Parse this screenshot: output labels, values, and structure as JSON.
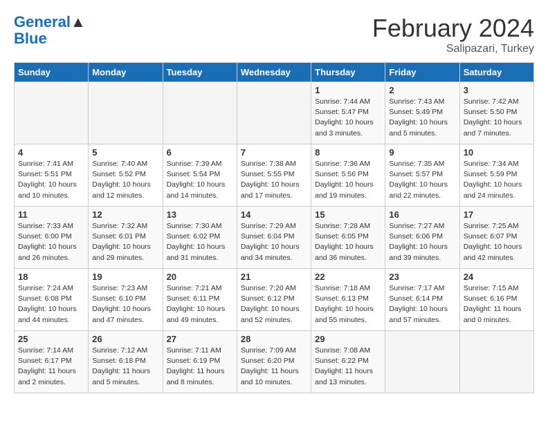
{
  "header": {
    "logo_line1": "General",
    "logo_line2": "Blue",
    "month": "February 2024",
    "location": "Salipazari, Turkey"
  },
  "weekdays": [
    "Sunday",
    "Monday",
    "Tuesday",
    "Wednesday",
    "Thursday",
    "Friday",
    "Saturday"
  ],
  "weeks": [
    [
      {
        "day": "",
        "info": ""
      },
      {
        "day": "",
        "info": ""
      },
      {
        "day": "",
        "info": ""
      },
      {
        "day": "",
        "info": ""
      },
      {
        "day": "1",
        "info": "Sunrise: 7:44 AM\nSunset: 5:47 PM\nDaylight: 10 hours\nand 3 minutes."
      },
      {
        "day": "2",
        "info": "Sunrise: 7:43 AM\nSunset: 5:49 PM\nDaylight: 10 hours\nand 5 minutes."
      },
      {
        "day": "3",
        "info": "Sunrise: 7:42 AM\nSunset: 5:50 PM\nDaylight: 10 hours\nand 7 minutes."
      }
    ],
    [
      {
        "day": "4",
        "info": "Sunrise: 7:41 AM\nSunset: 5:51 PM\nDaylight: 10 hours\nand 10 minutes."
      },
      {
        "day": "5",
        "info": "Sunrise: 7:40 AM\nSunset: 5:52 PM\nDaylight: 10 hours\nand 12 minutes."
      },
      {
        "day": "6",
        "info": "Sunrise: 7:39 AM\nSunset: 5:54 PM\nDaylight: 10 hours\nand 14 minutes."
      },
      {
        "day": "7",
        "info": "Sunrise: 7:38 AM\nSunset: 5:55 PM\nDaylight: 10 hours\nand 17 minutes."
      },
      {
        "day": "8",
        "info": "Sunrise: 7:36 AM\nSunset: 5:56 PM\nDaylight: 10 hours\nand 19 minutes."
      },
      {
        "day": "9",
        "info": "Sunrise: 7:35 AM\nSunset: 5:57 PM\nDaylight: 10 hours\nand 22 minutes."
      },
      {
        "day": "10",
        "info": "Sunrise: 7:34 AM\nSunset: 5:59 PM\nDaylight: 10 hours\nand 24 minutes."
      }
    ],
    [
      {
        "day": "11",
        "info": "Sunrise: 7:33 AM\nSunset: 6:00 PM\nDaylight: 10 hours\nand 26 minutes."
      },
      {
        "day": "12",
        "info": "Sunrise: 7:32 AM\nSunset: 6:01 PM\nDaylight: 10 hours\nand 29 minutes."
      },
      {
        "day": "13",
        "info": "Sunrise: 7:30 AM\nSunset: 6:02 PM\nDaylight: 10 hours\nand 31 minutes."
      },
      {
        "day": "14",
        "info": "Sunrise: 7:29 AM\nSunset: 6:04 PM\nDaylight: 10 hours\nand 34 minutes."
      },
      {
        "day": "15",
        "info": "Sunrise: 7:28 AM\nSunset: 6:05 PM\nDaylight: 10 hours\nand 36 minutes."
      },
      {
        "day": "16",
        "info": "Sunrise: 7:27 AM\nSunset: 6:06 PM\nDaylight: 10 hours\nand 39 minutes."
      },
      {
        "day": "17",
        "info": "Sunrise: 7:25 AM\nSunset: 6:07 PM\nDaylight: 10 hours\nand 42 minutes."
      }
    ],
    [
      {
        "day": "18",
        "info": "Sunrise: 7:24 AM\nSunset: 6:08 PM\nDaylight: 10 hours\nand 44 minutes."
      },
      {
        "day": "19",
        "info": "Sunrise: 7:23 AM\nSunset: 6:10 PM\nDaylight: 10 hours\nand 47 minutes."
      },
      {
        "day": "20",
        "info": "Sunrise: 7:21 AM\nSunset: 6:11 PM\nDaylight: 10 hours\nand 49 minutes."
      },
      {
        "day": "21",
        "info": "Sunrise: 7:20 AM\nSunset: 6:12 PM\nDaylight: 10 hours\nand 52 minutes."
      },
      {
        "day": "22",
        "info": "Sunrise: 7:18 AM\nSunset: 6:13 PM\nDaylight: 10 hours\nand 55 minutes."
      },
      {
        "day": "23",
        "info": "Sunrise: 7:17 AM\nSunset: 6:14 PM\nDaylight: 10 hours\nand 57 minutes."
      },
      {
        "day": "24",
        "info": "Sunrise: 7:15 AM\nSunset: 6:16 PM\nDaylight: 11 hours\nand 0 minutes."
      }
    ],
    [
      {
        "day": "25",
        "info": "Sunrise: 7:14 AM\nSunset: 6:17 PM\nDaylight: 11 hours\nand 2 minutes."
      },
      {
        "day": "26",
        "info": "Sunrise: 7:12 AM\nSunset: 6:18 PM\nDaylight: 11 hours\nand 5 minutes."
      },
      {
        "day": "27",
        "info": "Sunrise: 7:11 AM\nSunset: 6:19 PM\nDaylight: 11 hours\nand 8 minutes."
      },
      {
        "day": "28",
        "info": "Sunrise: 7:09 AM\nSunset: 6:20 PM\nDaylight: 11 hours\nand 10 minutes."
      },
      {
        "day": "29",
        "info": "Sunrise: 7:08 AM\nSunset: 6:22 PM\nDaylight: 11 hours\nand 13 minutes."
      },
      {
        "day": "",
        "info": ""
      },
      {
        "day": "",
        "info": ""
      }
    ]
  ]
}
